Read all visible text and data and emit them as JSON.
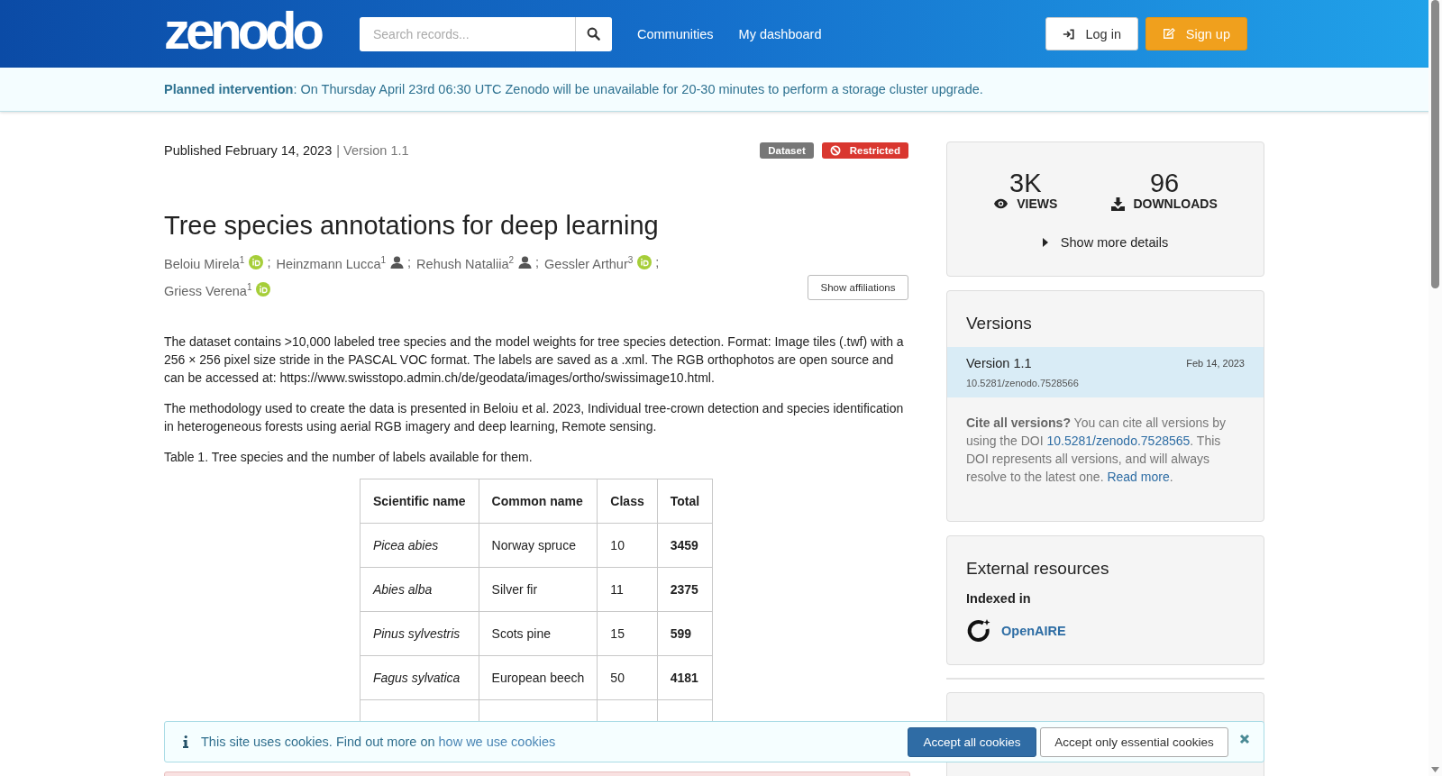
{
  "header": {
    "logo": "zenodo",
    "search": {
      "placeholder": "Search records..."
    },
    "nav": [
      "Communities",
      "My dashboard"
    ],
    "buttons": [
      {
        "label": "Log in",
        "kind": "login"
      },
      {
        "label": "Sign up",
        "kind": "signup"
      }
    ]
  },
  "banner": "**Planned intervention**: On Thursday April 23rd 06:30 UTC Zenodo will be unavailable for 20-30 minutes to perform a storage cluster upgrade.",
  "record": {
    "published": "Published February 14, 2023",
    "version": "| Version 1.1",
    "badges": [
      {
        "label": "Dataset",
        "kind": "type"
      },
      {
        "label": "Restricted",
        "kind": "access"
      }
    ],
    "title": "Tree species annotations for deep learning",
    "creators": [
      {
        "name": "Beloiu Mirela",
        "sup": "1",
        "kind": "orcid",
        "separator": ";"
      },
      {
        "name": "Heinzmann Lucca",
        "sup": "1",
        "kind": "person",
        "separator": ";"
      },
      {
        "name": "Rehush Nataliia",
        "sup": "2",
        "kind": "person",
        "separator": ";"
      },
      {
        "name": "Gessler Arthur",
        "sup": "3",
        "kind": "orcid",
        "separator": ";"
      },
      {
        "name": "Griess Verena",
        "sup": "1",
        "kind": "orcid"
      }
    ],
    "show_affiliations": "Show affiliations",
    "paragraphs": [
      "The dataset contains >10,000 labeled tree species and the model weights for tree species detection. Format: Image tiles (.twf) with a 256 × 256 pixel size stride in the PASCAL VOC format. The labels are saved as a .xml. The RGB orthophotos are open source and can be accessed at: https://www.swisstopo.admin.ch/de/geodata/images/ortho/swissimage10.html.",
      "The methodology used to create the data is presented in Beloiu et al. 2023, Individual tree-crown detection and species identification in heterogeneous forests using aerial RGB imagery and deep learning, Remote sensing.",
      "Table 1. Tree species and the number of labels available for them."
    ],
    "table": {
      "columns": [
        "Scientific name",
        "Common name",
        "Class",
        "Total"
      ],
      "rows": [
        [
          "Picea abies",
          "Norway spruce",
          "10",
          "3459"
        ],
        [
          "Abies alba",
          "Silver fir",
          "11",
          "2375"
        ],
        [
          "Pinus sylvestris",
          "Scots pine",
          "15",
          "599"
        ],
        [
          "Fagus sylvatica",
          "European beech",
          "50",
          "4181"
        ]
      ]
    }
  },
  "stats": {
    "items": [
      {
        "value": "3K",
        "label": "VIEWS",
        "kind": "views"
      },
      {
        "value": "96",
        "label": "DOWNLOADS",
        "kind": "downloads"
      }
    ],
    "show_more": "Show more details"
  },
  "versions": {
    "title": "Versions",
    "items": [
      {
        "label": "Version 1.1",
        "date": "Feb 14, 2023",
        "doi": "10.5281/zenodo.7528566",
        "selected": true
      }
    ],
    "cite": [
      {
        "kind": "text",
        "text": "**Cite all versions?** You can cite all versions by using the DOI "
      },
      {
        "kind": "link",
        "text": "10.5281/zenodo.7528565"
      },
      {
        "kind": "text",
        "text": ". This DOI represents all versions, and will always resolve to the latest one. "
      },
      {
        "kind": "link",
        "text": "Read more"
      },
      {
        "kind": "text",
        "text": "."
      }
    ]
  },
  "external": {
    "title": "External resources",
    "subtitle": "Indexed in",
    "items": [
      {
        "name": "OpenAIRE"
      }
    ]
  },
  "cookies": {
    "message": "This site uses cookies. Find out more on",
    "link": "how we use cookies",
    "buttons": [
      {
        "label": "Accept all cookies",
        "kind": "primary"
      },
      {
        "label": "Accept only essential cookies",
        "kind": "default"
      }
    ]
  }
}
